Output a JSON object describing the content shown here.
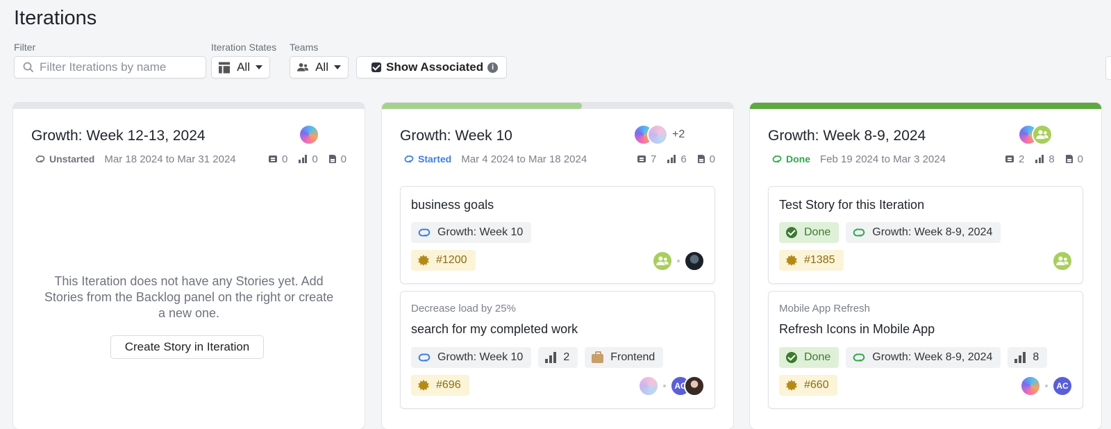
{
  "page": {
    "title": "Iterations"
  },
  "filters": {
    "filter_label": "Filter",
    "search_placeholder": "Filter Iterations by name",
    "states_label": "Iteration States",
    "states_value": "All",
    "teams_label": "Teams",
    "teams_value": "All",
    "show_associated_label": "Show Associated",
    "show_associated_checked": true,
    "info_glyph": "i"
  },
  "colors": {
    "started": "#3d7fe0",
    "done": "#2fa84a",
    "unstarted": "#6f747c",
    "progress_started": "#a6d08f",
    "progress_done": "#5ea840"
  },
  "iterations": [
    {
      "name": "Growth: Week 12-13, 2024",
      "state": "Unstarted",
      "dates": "Mar 18 2024 to Mar 31 2024",
      "counts": {
        "comments": "0",
        "points": "0",
        "docs": "0"
      },
      "progress": 0,
      "empty_message": "This Iteration does not have any Stories yet. Add Stories from the Backlog panel on the right or create a new one.",
      "create_button": "Create Story in Iteration"
    },
    {
      "name": "Growth: Week 10",
      "state": "Started",
      "dates": "Mar 4 2024 to Mar 18 2024",
      "counts": {
        "comments": "7",
        "points": "6",
        "docs": "0"
      },
      "progress": 0.57,
      "extra_members": "+2",
      "stories": [
        {
          "epic": "",
          "title": "business goals",
          "iteration_chip": "Growth: Week 10",
          "id": "#1200"
        },
        {
          "epic": "Decrease load by 25%",
          "title": "search for my completed work",
          "iteration_chip": "Growth: Week 10",
          "estimate": "2",
          "team": "Frontend",
          "id": "#696",
          "owner_initials": "AC"
        }
      ]
    },
    {
      "name": "Growth: Week 8-9, 2024",
      "state": "Done",
      "dates": "Feb 19 2024 to Mar 3 2024",
      "counts": {
        "comments": "2",
        "points": "8",
        "docs": "0"
      },
      "progress": 1.0,
      "stories": [
        {
          "epic": "",
          "title": "Test Story for this Iteration",
          "status": "Done",
          "iteration_chip": "Growth: Week 8-9, 2024",
          "id": "#1385"
        },
        {
          "epic": "Mobile App Refresh",
          "title": "Refresh Icons in Mobile App",
          "status": "Done",
          "iteration_chip": "Growth: Week 8-9, 2024",
          "estimate": "8",
          "id": "#660",
          "owner_initials": "AC"
        }
      ]
    }
  ]
}
